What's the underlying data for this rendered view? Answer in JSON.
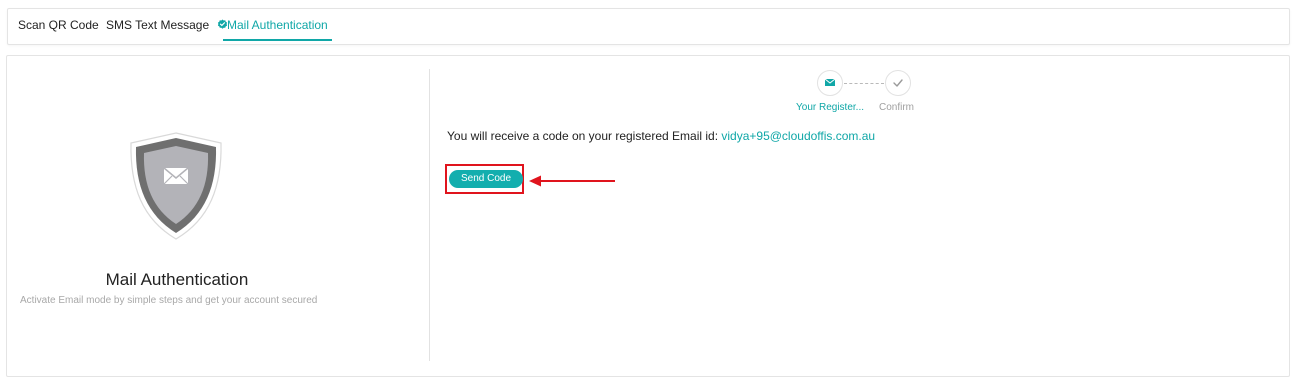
{
  "tabs": [
    {
      "label": "Scan QR Code"
    },
    {
      "label": "SMS Text Message",
      "verified": true
    },
    {
      "label": "Mail Authentication",
      "active": true
    }
  ],
  "left_panel": {
    "title": "Mail Authentication",
    "subtitle": "Activate Email mode by simple steps and get your account secured",
    "icon": "shield-mail-icon"
  },
  "stepper": {
    "steps": [
      {
        "label": "Your Register...",
        "icon": "mail-icon",
        "active": true
      },
      {
        "label": "Confirm",
        "icon": "check-icon",
        "active": false
      }
    ]
  },
  "content": {
    "message_prefix": "You will receive a code on your registered Email id:",
    "email": "vidya+95@cloudoffis.com.au",
    "send_button": "Send Code"
  },
  "colors": {
    "accent": "#10a7a7",
    "highlight": "#e0141d"
  }
}
